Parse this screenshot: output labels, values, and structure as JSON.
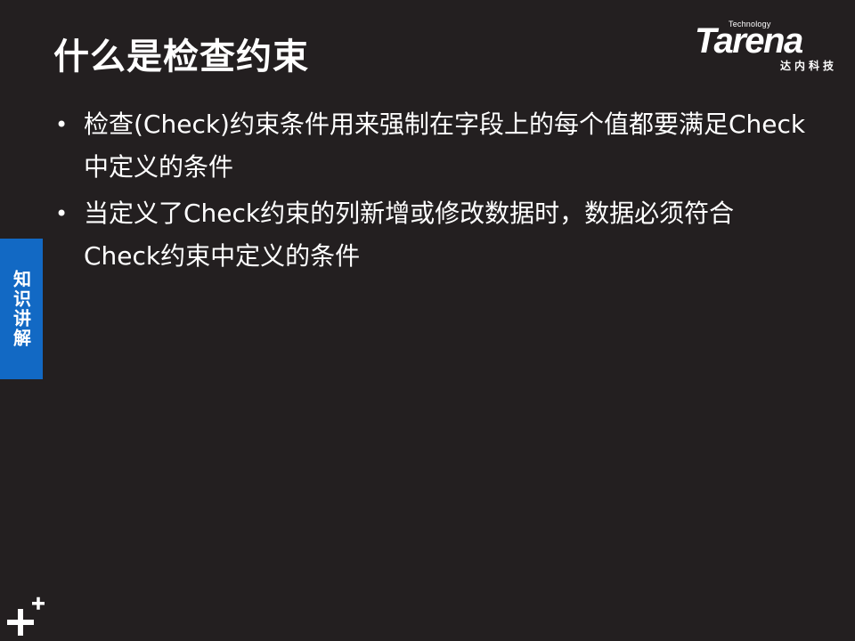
{
  "slide": {
    "title": "什么是检查约束",
    "bullets": [
      "检查(Check)约束条件用来强制在字段上的每个值都要满足Check中定义的条件",
      "当定义了Check约束的列新增或修改数据时，数据必须符合Check约束中定义的条件"
    ]
  },
  "logo": {
    "tagline": "Technology",
    "wordmark": "Tarena",
    "chinese": "达内科技"
  },
  "side_tab": {
    "label": "知识讲解"
  },
  "icons": {
    "bullet": "bullet-dot-icon",
    "corner": "plus-decoration-icon"
  },
  "colors": {
    "background": "#231f20",
    "side_tab": "#1269c4",
    "text": "#ffffff"
  }
}
